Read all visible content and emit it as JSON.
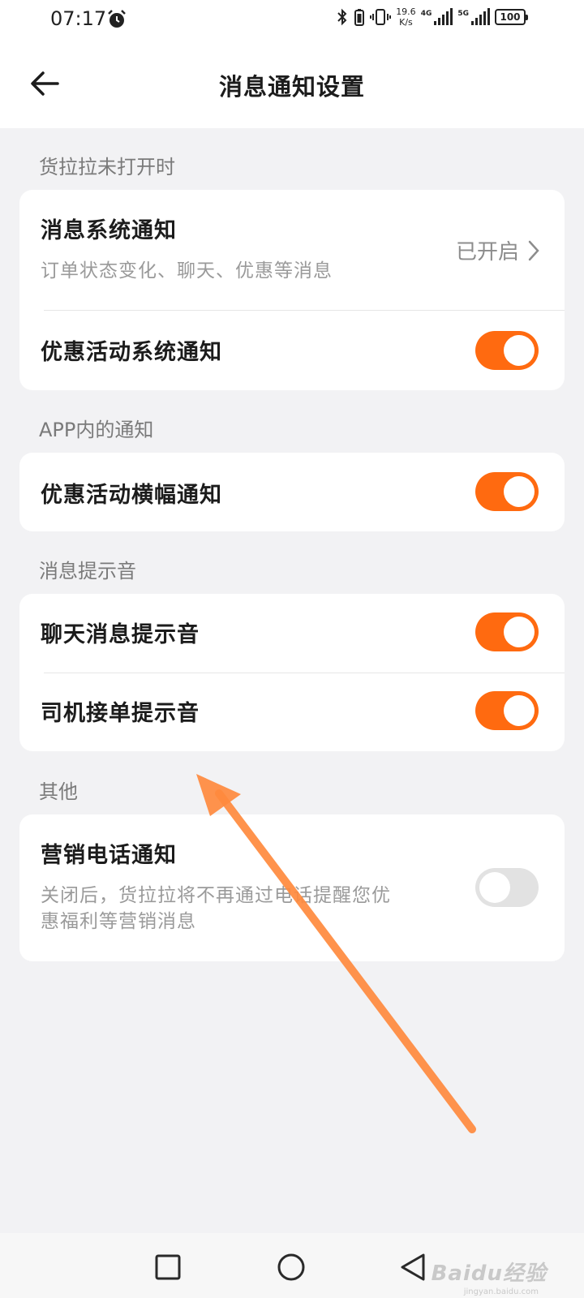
{
  "status_bar": {
    "time": "07:17",
    "alarm_icon": "alarm-icon",
    "net_speed_value": "19.6",
    "net_speed_unit": "K/s",
    "sim1_type": "4G",
    "sim2_type": "5G",
    "battery": "100"
  },
  "header": {
    "title": "消息通知设置",
    "back_icon": "back-arrow-icon"
  },
  "sections": {
    "closed_app": {
      "label": "货拉拉未打开时",
      "system_notify": {
        "title": "消息系统通知",
        "desc": "订单状态变化、聊天、优惠等消息",
        "value": "已开启"
      },
      "promo_system_notify": {
        "title": "优惠活动系统通知",
        "enabled": true
      }
    },
    "in_app": {
      "label": "APP内的通知",
      "promo_banner_notify": {
        "title": "优惠活动横幅通知",
        "enabled": true
      }
    },
    "sound": {
      "label": "消息提示音",
      "chat_sound": {
        "title": "聊天消息提示音",
        "enabled": true
      },
      "driver_accept_sound": {
        "title": "司机接单提示音",
        "enabled": true
      }
    },
    "other": {
      "label": "其他",
      "marketing_call": {
        "title": "营销电话通知",
        "desc_line1": "关闭后，货拉拉将不再通过电话提醒您优",
        "desc_line2": "惠福利等营销消息",
        "enabled": false
      }
    }
  },
  "colors": {
    "accent": "#ff6a10",
    "toggle_off": "#e2e2e2",
    "annotation_arrow": "#ff8a3d",
    "background": "#f2f2f4"
  },
  "watermark": {
    "text": "Baidu经验",
    "sub": "jingyan.baidu.com"
  }
}
